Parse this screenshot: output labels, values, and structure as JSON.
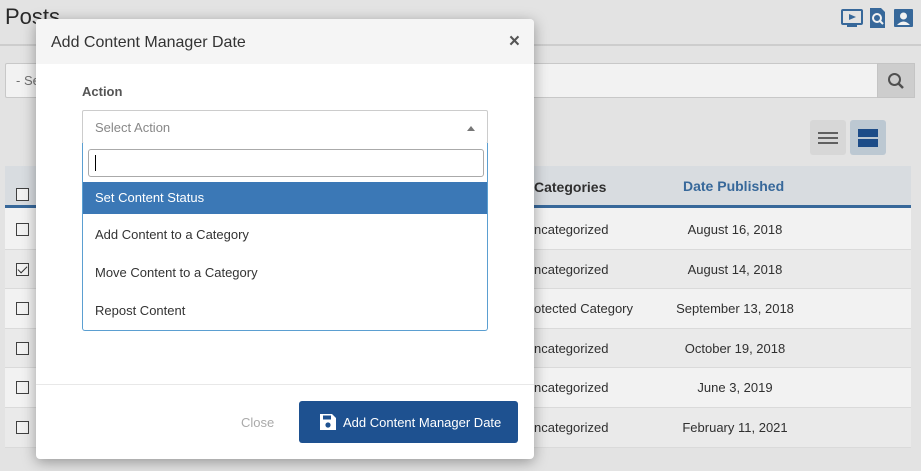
{
  "page": {
    "title": "Posts",
    "search_placeholder": "- Se",
    "icons": [
      "video-icon",
      "search-document-icon",
      "user-card-icon"
    ]
  },
  "table": {
    "headers": {
      "categories": "Categories",
      "date": "Date Published"
    },
    "rows": [
      {
        "category": "ncategorized",
        "date": "August 16, 2018",
        "checked": false
      },
      {
        "category": "ncategorized",
        "date": "August 14, 2018",
        "checked": true
      },
      {
        "category": "otected Category",
        "date": "September 13, 2018",
        "checked": false
      },
      {
        "category": "ncategorized",
        "date": "October 19, 2018",
        "checked": false
      },
      {
        "category": "ncategorized",
        "date": "June 3, 2019",
        "checked": false
      },
      {
        "category": "ncategorized",
        "date": "February 11, 2021",
        "checked": false
      }
    ]
  },
  "modal": {
    "title": "Add Content Manager Date",
    "close_symbol": "×",
    "action_label": "Action",
    "select_placeholder": "Select Action",
    "search_value": "",
    "options": [
      {
        "label": "Set Content Status",
        "active": true
      },
      {
        "label": "Add Content to a Category",
        "active": false
      },
      {
        "label": "Move Content to a Category",
        "active": false
      },
      {
        "label": "Repost Content",
        "active": false
      }
    ],
    "close_button": "Close",
    "submit_button": "Add Content Manager Date"
  },
  "colors": {
    "primary": "#1e5190",
    "highlight": "#3b78b6",
    "link": "#3a6ea3"
  }
}
